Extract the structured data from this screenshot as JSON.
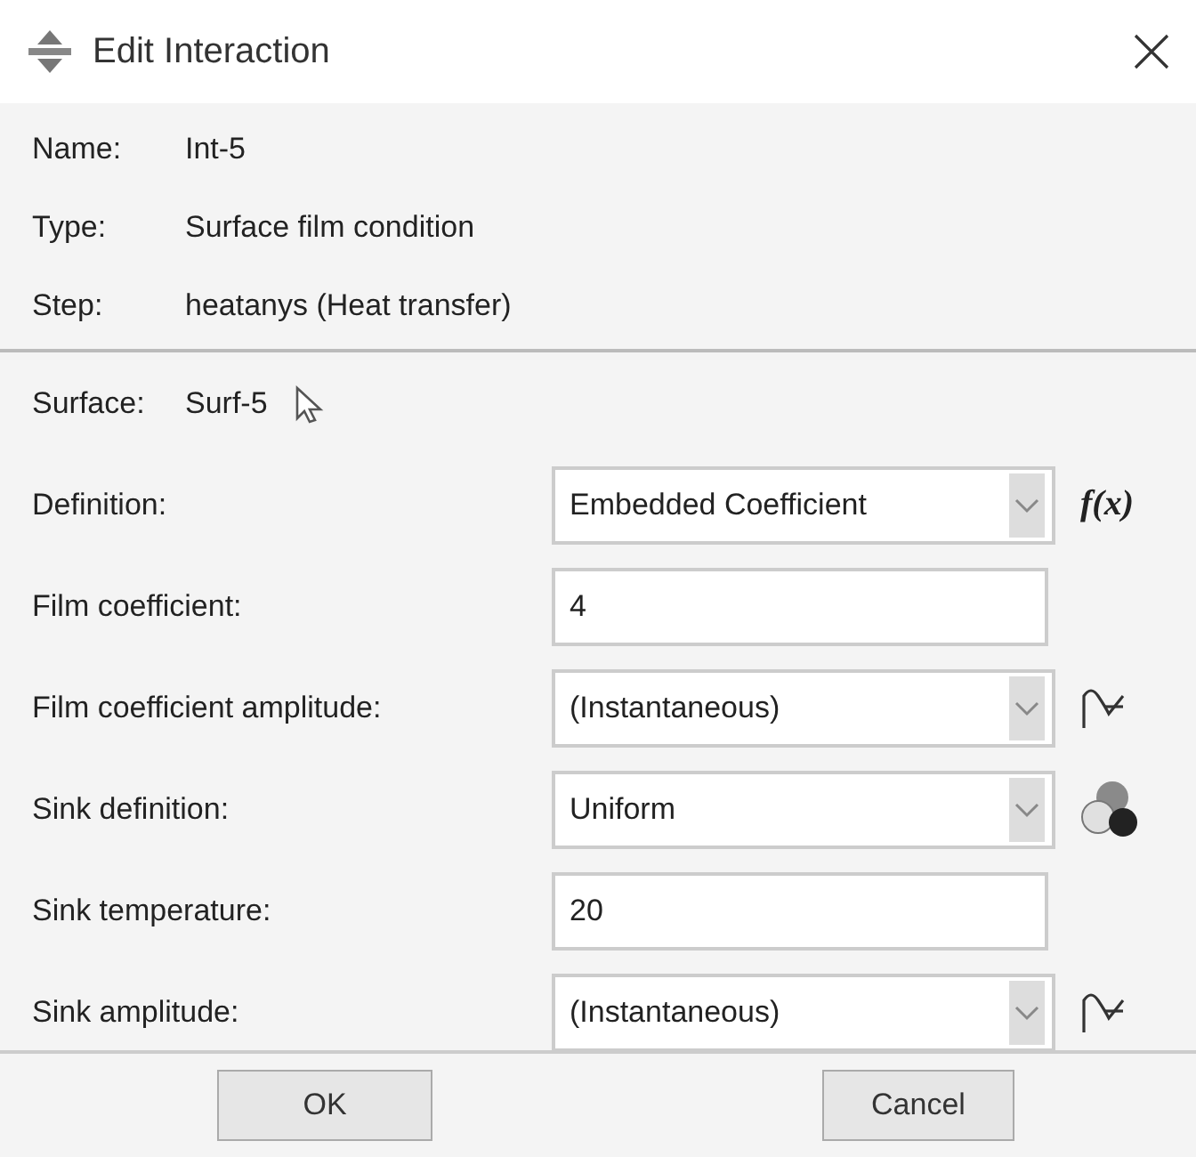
{
  "window": {
    "title": "Edit Interaction"
  },
  "header": [
    {
      "label": "Name:",
      "value": "Int-5"
    },
    {
      "label": "Type:",
      "value": "Surface film condition"
    },
    {
      "label": "Step:",
      "value": "heatanys (Heat transfer)"
    }
  ],
  "surface": {
    "label": "Surface:",
    "value": "Surf-5"
  },
  "rows": [
    {
      "label": "Definition:",
      "kind": "select_function",
      "value": "Embedded Coefficient",
      "icon_text": "f(x)"
    },
    {
      "label": "Film coefficient:",
      "kind": "text",
      "value": "4"
    },
    {
      "label": "Film coefficient amplitude:",
      "kind": "select_amplitude",
      "value": "(Instantaneous)"
    },
    {
      "label": "Sink definition:",
      "kind": "select_distribution",
      "value": "Uniform"
    },
    {
      "label": "Sink temperature:",
      "kind": "text",
      "value": "20"
    },
    {
      "label": "Sink amplitude:",
      "kind": "select_amplitude",
      "value": "(Instantaneous)"
    }
  ],
  "buttons": [
    "OK",
    "Cancel"
  ]
}
